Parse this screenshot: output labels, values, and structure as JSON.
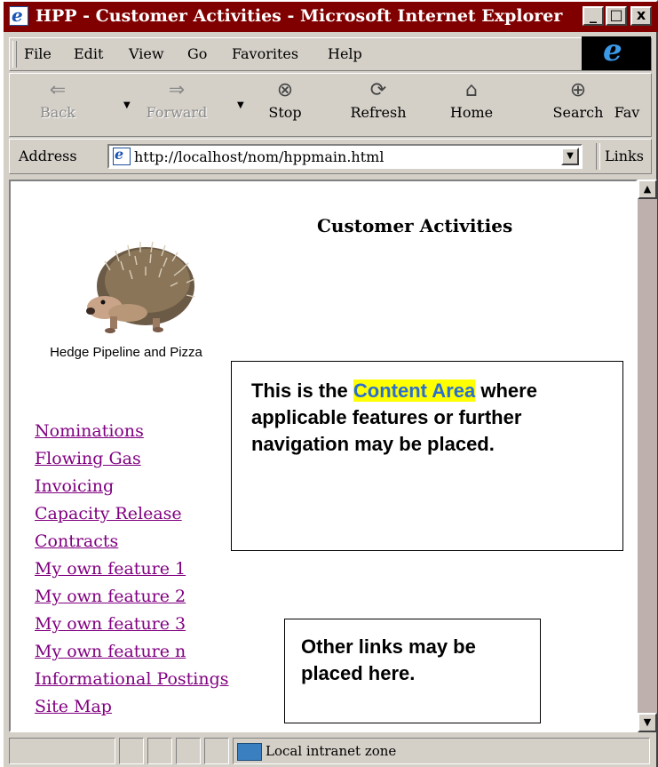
{
  "window": {
    "title": "HPP - Customer Activities - Microsoft Internet Explorer",
    "controls": [
      "_",
      "□",
      "x"
    ]
  },
  "menu": [
    "File",
    "Edit",
    "View",
    "Go",
    "Favorites",
    "Help"
  ],
  "toolbar": {
    "back": "Back",
    "forward": "Forward",
    "stop": "Stop",
    "refresh": "Refresh",
    "home": "Home",
    "search": "Search",
    "favorites": "Fav"
  },
  "address": {
    "label": "Address",
    "url": "http://localhost/nom/hppmain.html",
    "links_label": "Links"
  },
  "page": {
    "title": "Customer Activities",
    "company": "Hedge Pipeline and Pizza",
    "nav_links": [
      "Nominations",
      "Flowing Gas",
      "Invoicing",
      "Capacity Release",
      "Contracts",
      "My own feature 1",
      "My own feature 2",
      "My own feature 3",
      "My own feature n",
      "Informational Postings",
      "Site Map"
    ],
    "callout_content_prefix": "This is the ",
    "callout_content_highlight": "Content Area",
    "callout_content_rest": "where  applicable features or further navigation may be placed.",
    "callout_links": "Other links may be placed here."
  },
  "status": {
    "zone": "Local intranet zone"
  },
  "colors": {
    "titlebar": "#800000",
    "visited_link": "#800080",
    "highlight": "#ffff00",
    "highlight_text": "#2a6fd0"
  }
}
